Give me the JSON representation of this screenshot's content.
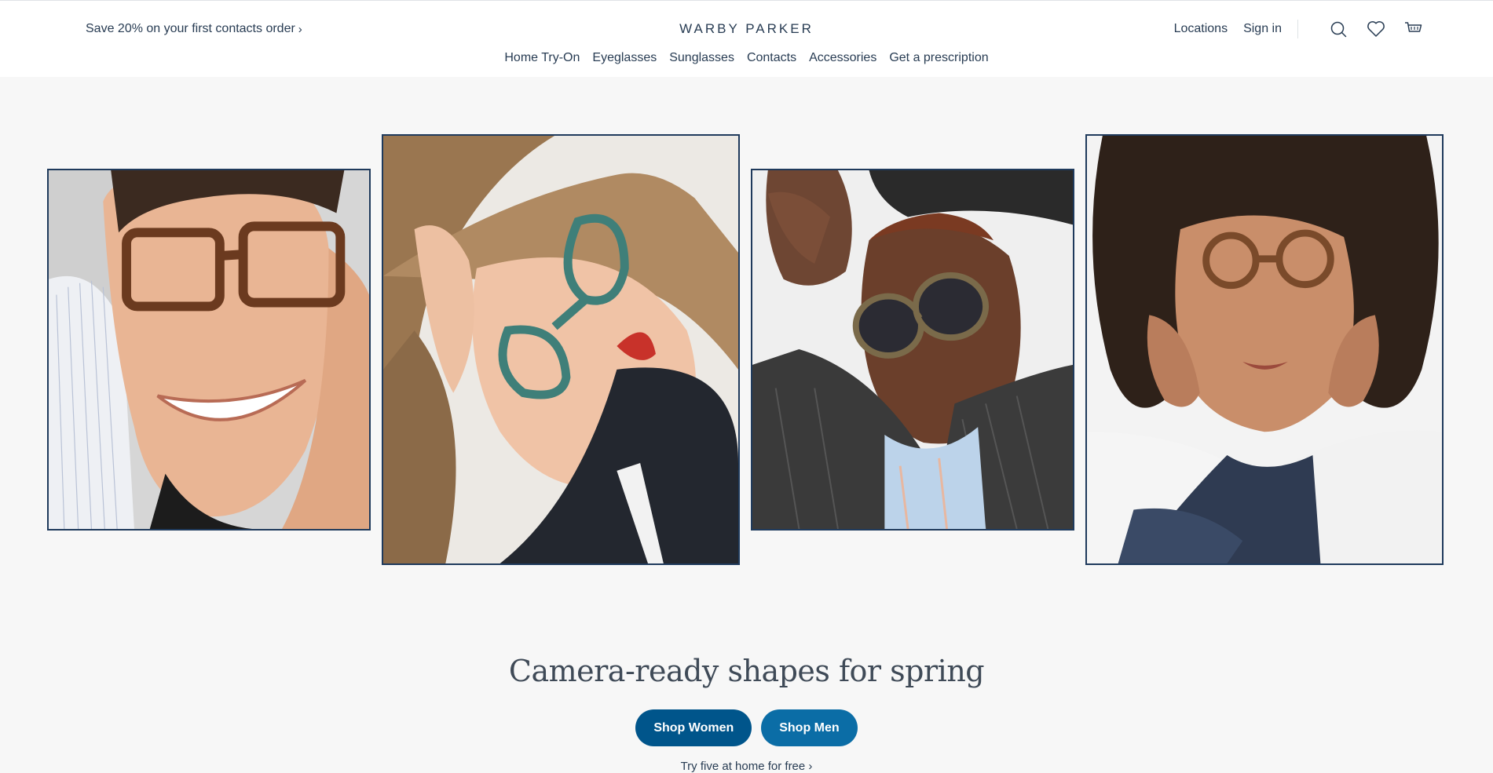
{
  "header": {
    "promo_text": "Save 20% on your first contacts order",
    "promo_chevron": "›",
    "logo": "WARBY PARKER",
    "utility_links": [
      "Locations",
      "Sign in"
    ],
    "icons": [
      "search-icon",
      "heart-icon",
      "cart-icon"
    ]
  },
  "nav": {
    "items": [
      "Home Try-On",
      "Eyeglasses",
      "Sunglasses",
      "Contacts",
      "Accessories",
      "Get a prescription"
    ]
  },
  "hero": {
    "images": [
      {
        "subject": "man smiling in tortoiseshell eyeglasses"
      },
      {
        "subject": "woman with long hair in green eyeglasses"
      },
      {
        "subject": "man in multicolor tortoise sunglasses"
      },
      {
        "subject": "woman with curly hair in tortoiseshell eyeglasses"
      }
    ],
    "headline": "Camera-ready shapes for spring",
    "cta_women": "Shop Women",
    "cta_men": "Shop Men",
    "try_link": "Try five at home for free",
    "try_chevron": "›"
  },
  "colors": {
    "text": "#283c53",
    "primary_button": "#00558b",
    "secondary_button": "#0b6da6",
    "page_background": "#f7f7f7",
    "frame_border": "#1f3a5c"
  }
}
